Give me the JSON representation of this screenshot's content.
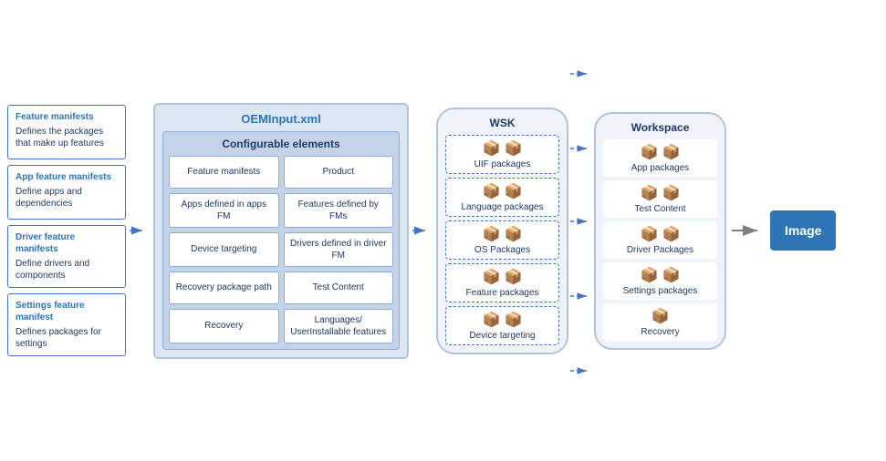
{
  "left_panel": {
    "items": [
      {
        "title": "Feature manifests",
        "desc": "Defines the packages that make up features"
      },
      {
        "title": "App feature manifests",
        "desc": "Define apps and dependencies"
      },
      {
        "title": "Driver feature manifests",
        "desc": "Define drivers and components"
      },
      {
        "title": "Settings feature manifest",
        "desc": "Defines packages for settings"
      }
    ]
  },
  "oem": {
    "title": "OEMInput.xml",
    "configurable_title": "Configurable elements",
    "cells": [
      "Feature manifests",
      "Product",
      "Apps defined in apps FM",
      "Features defined by FMs",
      "Device targeting",
      "Drivers defined in driver FM",
      "Recovery package path",
      "Test Content",
      "Recovery",
      "Languages/ UserInstallable features"
    ]
  },
  "wsk": {
    "title": "WSK",
    "items": [
      {
        "label": "UIF packages"
      },
      {
        "label": "Language packages"
      },
      {
        "label": "OS Packages"
      },
      {
        "label": "Feature packages"
      },
      {
        "label": "Device targeting"
      }
    ]
  },
  "workspace": {
    "title": "Workspace",
    "items": [
      {
        "label": "App packages"
      },
      {
        "label": "Test Content"
      },
      {
        "label": "Driver Packages"
      },
      {
        "label": "Settings packages"
      },
      {
        "label": "Recovery"
      }
    ]
  },
  "image": {
    "label": "Image"
  }
}
